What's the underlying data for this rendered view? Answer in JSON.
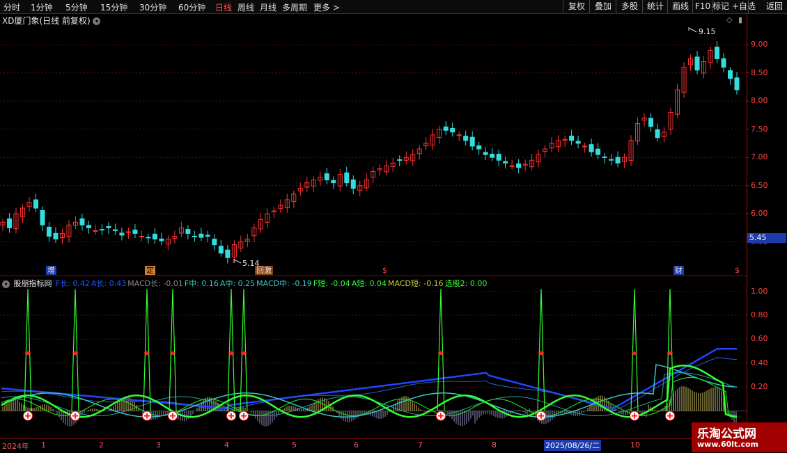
{
  "toolbar": {
    "periods": [
      "分时",
      "1分钟",
      "5分钟",
      "15分钟",
      "30分钟",
      "60分钟",
      "日线",
      "周线",
      "月线",
      "多周期",
      "更多 >"
    ],
    "active_period": "日线",
    "tools": [
      "复权",
      "叠加",
      "多股",
      "统计",
      "画线",
      "F10",
      "+自选",
      "返回"
    ],
    "mark_label": "标记"
  },
  "stock": {
    "title": "XD厦门象(日线 前复权)",
    "current_price": "5.45",
    "high_label": "9.15",
    "low_label": "5.14"
  },
  "price_axis": [
    "9.00",
    "8.50",
    "8.00",
    "7.50",
    "7.00",
    "6.50",
    "6.00",
    "5.50"
  ],
  "events": [
    {
      "label": "增",
      "color": "#e8e8e8",
      "bg": "#1e3aa8"
    },
    {
      "label": "定",
      "color": "#000",
      "bg": "#d08030"
    },
    {
      "label": "回激",
      "color": "#e8e8e8",
      "bg": "#8a4010"
    },
    {
      "label": "$",
      "color": "#ff4444",
      "bg": "transparent"
    },
    {
      "label": "财",
      "color": "#e8e8e8",
      "bg": "#1e3aa8"
    },
    {
      "label": "$",
      "color": "#ff4444",
      "bg": "transparent"
    }
  ],
  "indicator": {
    "name": "股朋指标网",
    "fields": [
      {
        "text": "F长: 0.42",
        "color": "#2255ff"
      },
      {
        "text": "A长: 0.43",
        "color": "#2255ff"
      },
      {
        "text": "MACD长: -0.01",
        "color": "#888888"
      },
      {
        "text": "F中: 0.16",
        "color": "#39c6c6"
      },
      {
        "text": "A中: 0.25",
        "color": "#39c6c6"
      },
      {
        "text": "MACD中: -0.19",
        "color": "#39c6c6"
      },
      {
        "text": "F短: -0.04",
        "color": "#33ff33"
      },
      {
        "text": "A短: 0.04",
        "color": "#33ff33"
      },
      {
        "text": "MACD短: -0.16",
        "color": "#cccc33"
      },
      {
        "text": "选股2: 0.00",
        "color": "#33ff33"
      }
    ],
    "axis": [
      "1.00",
      "0.80",
      "0.60",
      "0.40",
      "0.20"
    ]
  },
  "date_axis": {
    "year_label": "2024年",
    "months": [
      "1",
      "2",
      "3",
      "4",
      "5",
      "6",
      "7",
      "8",
      "9",
      "10"
    ],
    "selected_date": "2025/08/26/二"
  },
  "watermark": {
    "title": "乐淘公式网",
    "url": "www.60lt.com"
  },
  "chart_data": {
    "type": "candlestick",
    "series_close_approx": [
      5.85,
      5.75,
      6.0,
      6.1,
      6.2,
      6.1,
      5.8,
      5.6,
      5.55,
      5.65,
      5.8,
      5.85,
      5.8,
      5.75,
      5.7,
      5.72,
      5.75,
      5.7,
      5.62,
      5.68,
      5.65,
      5.6,
      5.58,
      5.55,
      5.52,
      5.55,
      5.6,
      5.75,
      5.65,
      5.6,
      5.58,
      5.6,
      5.45,
      5.3,
      5.22,
      5.45,
      5.5,
      5.55,
      5.75,
      5.9,
      6.0,
      6.05,
      6.15,
      6.25,
      6.35,
      6.45,
      6.55,
      6.6,
      6.65,
      6.6,
      6.55,
      6.7,
      6.55,
      6.45,
      6.5,
      6.6,
      6.75,
      6.8,
      6.85,
      6.9,
      6.95,
      7.0,
      7.05,
      7.15,
      7.25,
      7.4,
      7.5,
      7.48,
      7.45,
      7.4,
      7.3,
      7.2,
      7.15,
      7.05,
      7.0,
      6.95,
      6.9,
      6.85,
      6.82,
      6.88,
      6.95,
      7.05,
      7.15,
      7.25,
      7.3,
      7.32,
      7.3,
      7.25,
      7.2,
      7.1,
      7.05,
      7.0,
      6.95,
      6.9,
      7.0,
      7.3,
      7.6,
      7.7,
      7.55,
      7.35,
      7.45,
      7.8,
      8.2,
      8.6,
      8.75,
      8.55,
      8.7,
      8.9,
      8.75,
      8.6,
      8.4,
      8.2
    ],
    "ylim": [
      5.1,
      9.3
    ],
    "indicator_ylim": [
      -0.2,
      1.05
    ]
  }
}
